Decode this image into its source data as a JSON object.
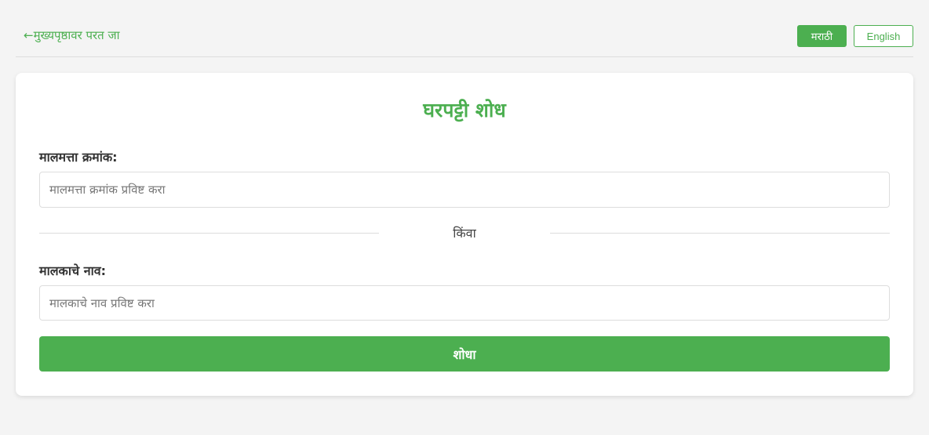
{
  "header": {
    "back_link": "←मुख्यपृष्ठावर परत जा",
    "languages": [
      {
        "label": "मराठी",
        "active": true
      },
      {
        "label": "English",
        "active": false
      }
    ]
  },
  "form": {
    "title": "घरपट्टी शोध",
    "property_number": {
      "label": "मालमत्ता क्रमांक:",
      "placeholder": "मालमत्ता क्रमांक प्रविष्ट करा",
      "value": ""
    },
    "divider_text": "किंवा",
    "owner_name": {
      "label": "मालकाचे नाव:",
      "placeholder": "मालकाचे नाव प्रविष्ट करा",
      "value": ""
    },
    "submit_label": "शोधा"
  },
  "colors": {
    "accent": "#4caf50",
    "background": "#f4f4f4",
    "card": "#ffffff",
    "border": "#dddddd"
  }
}
